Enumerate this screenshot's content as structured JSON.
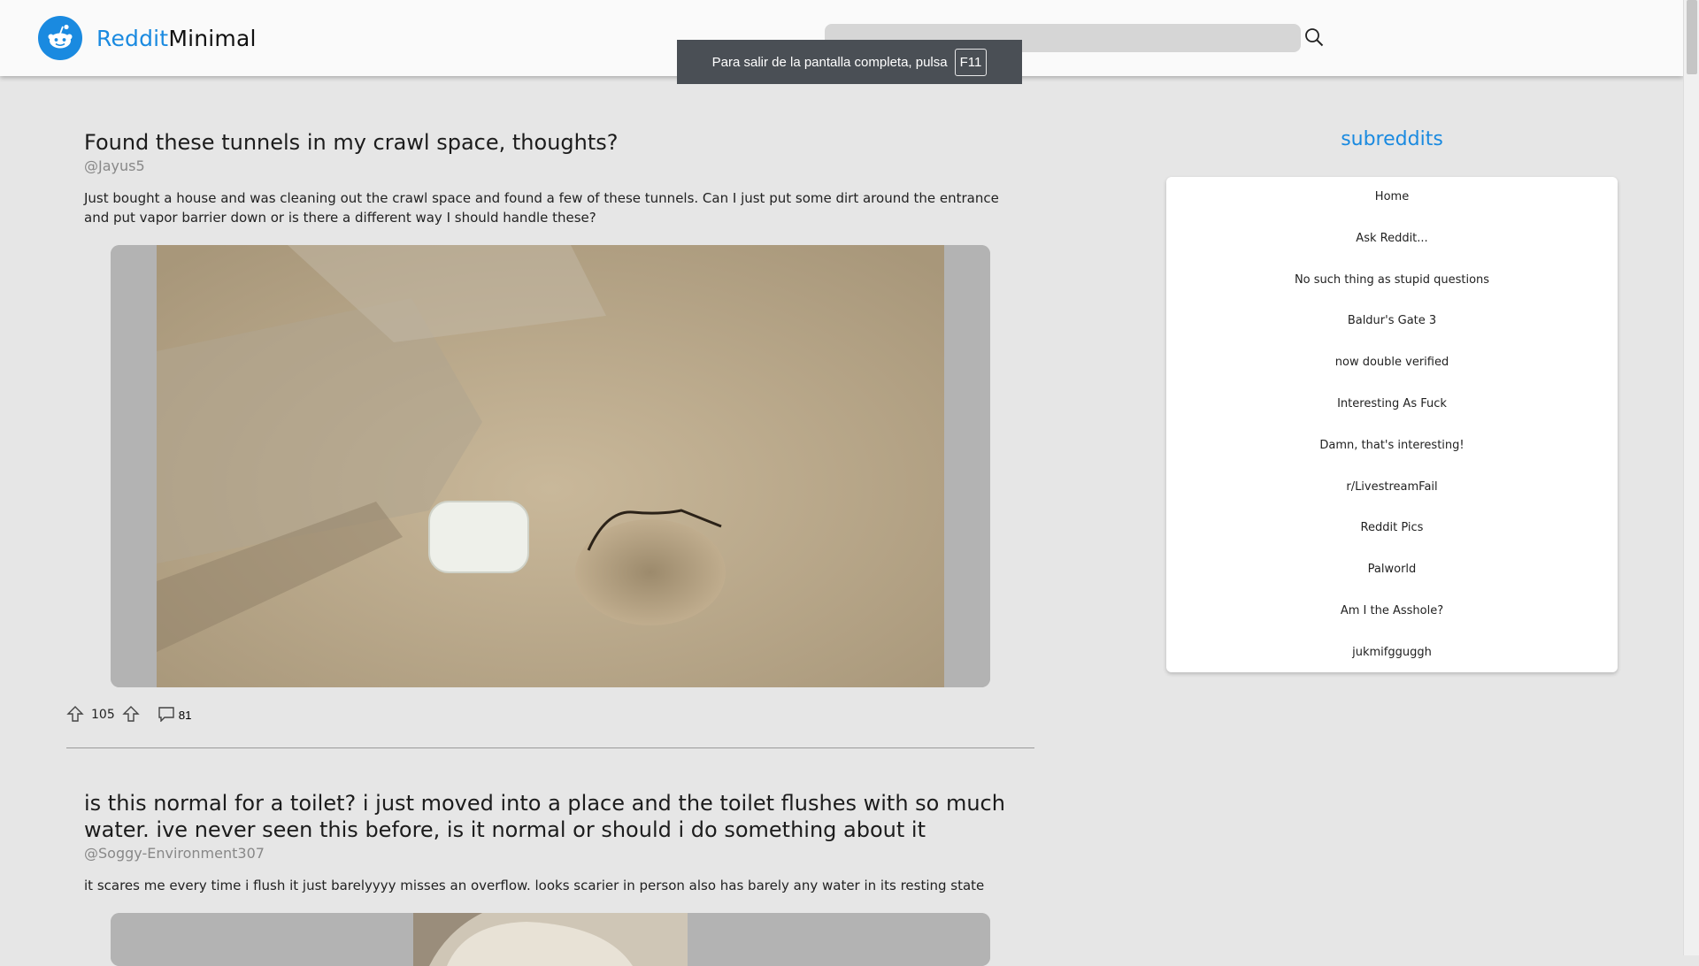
{
  "app": {
    "name_part1": "Reddit",
    "name_part2": "Minimal",
    "brand_color": "#1a8ae0"
  },
  "search": {
    "placeholder": "",
    "value": "",
    "icon": "search-icon"
  },
  "fullscreen_toast": {
    "text": "Para salir de la pantalla completa, pulsa",
    "key": "F11"
  },
  "posts": [
    {
      "title": "Found these tunnels in my crawl space, thoughts?",
      "author": "@Jayus5",
      "text": "Just bought a house and was cleaning out the crawl space and found a few of these tunnels. Can I just put some dirt around the entrance and put vapor barrier down or is there a different way I should handle these?",
      "image": "photo of dirt crawl space floor with tunnel hole and white earbuds case",
      "votes": "105",
      "comments": "81"
    },
    {
      "title": "is this normal for a toilet? i just moved into a place and the toilet flushes with so much water. ive never seen this before, is it normal or should i do something about it",
      "author": "@Soggy-Environment307",
      "text": "it scares me every time i flush it just barelyyyy misses an overflow. looks scarier in person also has barely any water in its resting state",
      "image": "photo of toilet"
    }
  ],
  "sidebar": {
    "title": "subreddits",
    "items": [
      {
        "label": "Home"
      },
      {
        "label": "Ask Reddit..."
      },
      {
        "label": "No such thing as stupid questions"
      },
      {
        "label": "Baldur's Gate 3"
      },
      {
        "label": "now double verified"
      },
      {
        "label": "Interesting As Fuck"
      },
      {
        "label": "Damn, that's interesting!"
      },
      {
        "label": "r/LivestreamFail"
      },
      {
        "label": "Reddit Pics"
      },
      {
        "label": "Palworld"
      },
      {
        "label": "Am I the Asshole?"
      },
      {
        "label": "jukmifgguggh"
      }
    ]
  }
}
